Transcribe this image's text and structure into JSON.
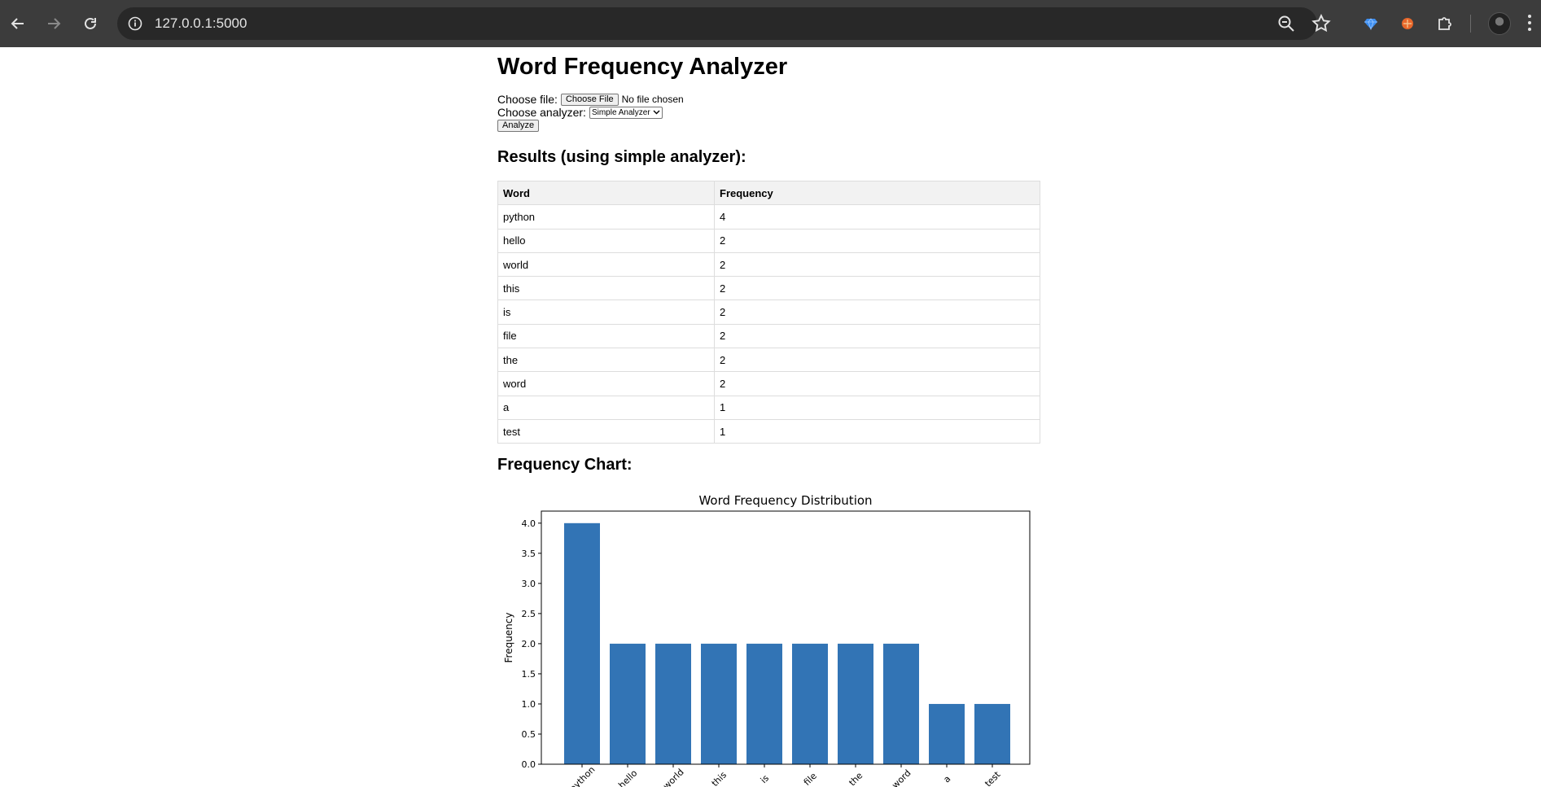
{
  "browser": {
    "url": "127.0.0.1:5000"
  },
  "page": {
    "title": "Word Frequency Analyzer",
    "form": {
      "file_label": "Choose file:",
      "file_button": "Choose File",
      "file_status": "No file chosen",
      "analyzer_label": "Choose analyzer:",
      "analyzer_selected": "Simple Analyzer",
      "analyze_button": "Analyze"
    },
    "results_heading": "Results (using simple analyzer):",
    "table": {
      "headers": [
        "Word",
        "Frequency"
      ],
      "rows": [
        [
          "python",
          "4"
        ],
        [
          "hello",
          "2"
        ],
        [
          "world",
          "2"
        ],
        [
          "this",
          "2"
        ],
        [
          "is",
          "2"
        ],
        [
          "file",
          "2"
        ],
        [
          "the",
          "2"
        ],
        [
          "word",
          "2"
        ],
        [
          "a",
          "1"
        ],
        [
          "test",
          "1"
        ]
      ]
    },
    "chart_heading": "Frequency Chart:"
  },
  "chart_data": {
    "type": "bar",
    "title": "Word Frequency Distribution",
    "xlabel": "",
    "ylabel": "Frequency",
    "categories": [
      "python",
      "hello",
      "world",
      "this",
      "is",
      "file",
      "the",
      "word",
      "a",
      "test"
    ],
    "values": [
      4,
      2,
      2,
      2,
      2,
      2,
      2,
      2,
      1,
      1
    ],
    "ylim": [
      0,
      4.2
    ],
    "yticks": [
      "0.0",
      "0.5",
      "1.0",
      "1.5",
      "2.0",
      "2.5",
      "3.0",
      "3.5",
      "4.0"
    ],
    "bar_color": "#3274b5",
    "grid": false,
    "legend": "none"
  }
}
